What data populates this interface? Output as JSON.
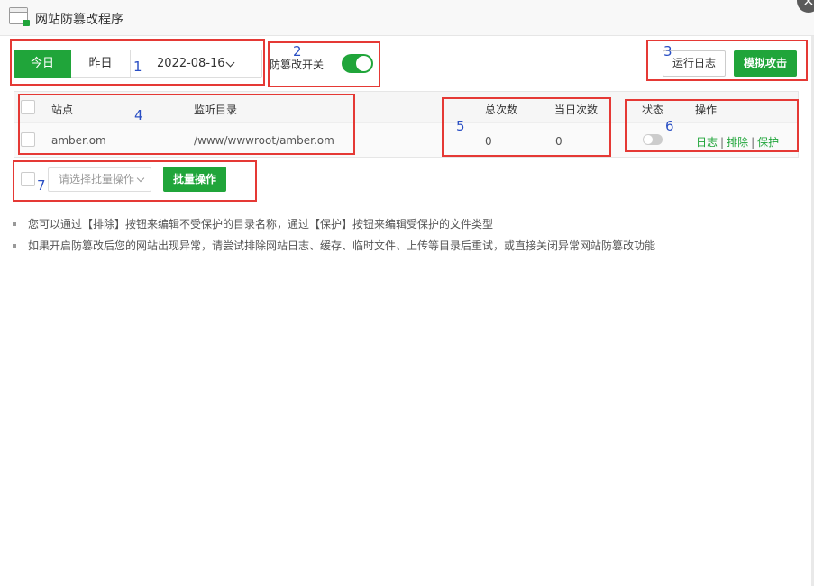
{
  "window": {
    "title": "网站防篡改程序",
    "close_glyph": "×"
  },
  "filters": {
    "today": "今日",
    "yesterday": "昨日",
    "date": "2022-08-16"
  },
  "toggle": {
    "label": "防篡改开关",
    "on": true
  },
  "buttons": {
    "run_log": "运行日志",
    "simulate_attack": "模拟攻击"
  },
  "table": {
    "headers": {
      "site": "站点",
      "dir": "监听目录",
      "total": "总次数",
      "today": "当日次数",
      "status": "状态",
      "ops": "操作"
    },
    "rows": [
      {
        "site": "amber.om",
        "dir": "/www/wwwroot/amber.om",
        "total": "0",
        "today": "0",
        "status_on": false,
        "op_log": "日志",
        "op_exclude": "排除",
        "op_protect": "保护",
        "sep": "|"
      }
    ]
  },
  "batch": {
    "placeholder": "请选择批量操作",
    "button": "批量操作"
  },
  "tips": [
    "您可以通过【排除】按钮来编辑不受保护的目录名称，通过【保护】按钮来编辑受保护的文件类型",
    "如果开启防篡改后您的网站出现异常，请尝试排除网站日志、缓存、临时文件、上传等目录后重试，或直接关闭异常网站防篡改功能"
  ],
  "annotations": [
    "1",
    "2",
    "3",
    "4",
    "5",
    "6",
    "7"
  ],
  "colors": {
    "accent": "#20a53a",
    "annotation_box": "#e53935",
    "annotation_number": "#2a4fc4"
  }
}
